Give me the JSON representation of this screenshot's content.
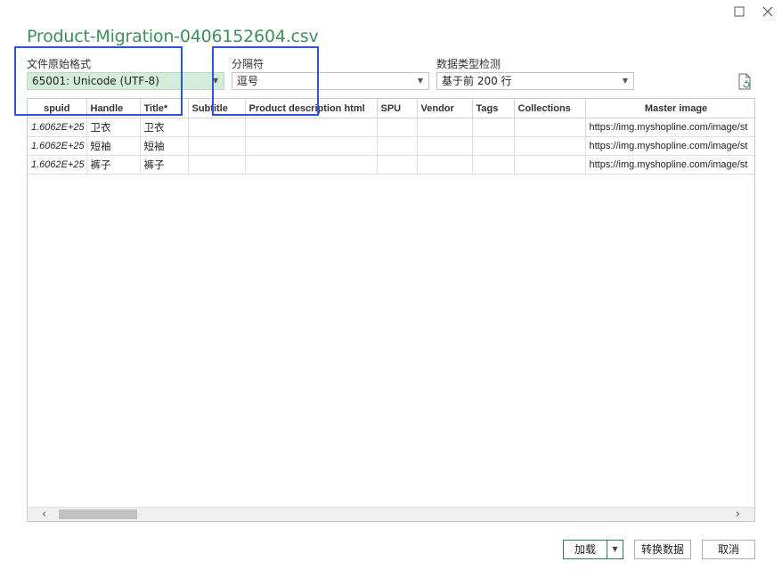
{
  "window": {
    "title": "Product-Migration-0406152604.csv",
    "maximize_icon": "maximize-icon",
    "close_icon": "close-icon"
  },
  "options": {
    "encoding": {
      "label": "文件原始格式",
      "value": "65001: Unicode (UTF-8)"
    },
    "delimiter": {
      "label": "分隔符",
      "value": "逗号"
    },
    "detection": {
      "label": "数据类型检测",
      "value": "基于前 200 行"
    },
    "refresh_icon": "refresh-icon"
  },
  "table": {
    "columns": [
      "spuid",
      "Handle",
      "Title*",
      "Subtitle",
      "Product description html",
      "SPU",
      "Vendor",
      "Tags",
      "Collections",
      "Master image"
    ],
    "rows": [
      [
        "1.6062E+25",
        "卫衣",
        "卫衣",
        "",
        "",
        "",
        "",
        "",
        "",
        "https://img.myshopline.com/image/st"
      ],
      [
        "1.6062E+25",
        "短袖",
        "短袖",
        "",
        "",
        "",
        "",
        "",
        "",
        "https://img.myshopline.com/image/st"
      ],
      [
        "1.6062E+25",
        "裤子",
        "裤子",
        "",
        "",
        "",
        "",
        "",
        "",
        "https://img.myshopline.com/image/st"
      ]
    ]
  },
  "scrollbar": {
    "left_arrow": "‹",
    "right_arrow": "›"
  },
  "buttons": {
    "load": "加载",
    "transform": "转换数据",
    "cancel": "取消"
  },
  "colors": {
    "title": "#3f8f5c",
    "highlight": "#2f55d4",
    "encoding_bg": "#d4edda",
    "load_border": "#2e7d4f"
  }
}
